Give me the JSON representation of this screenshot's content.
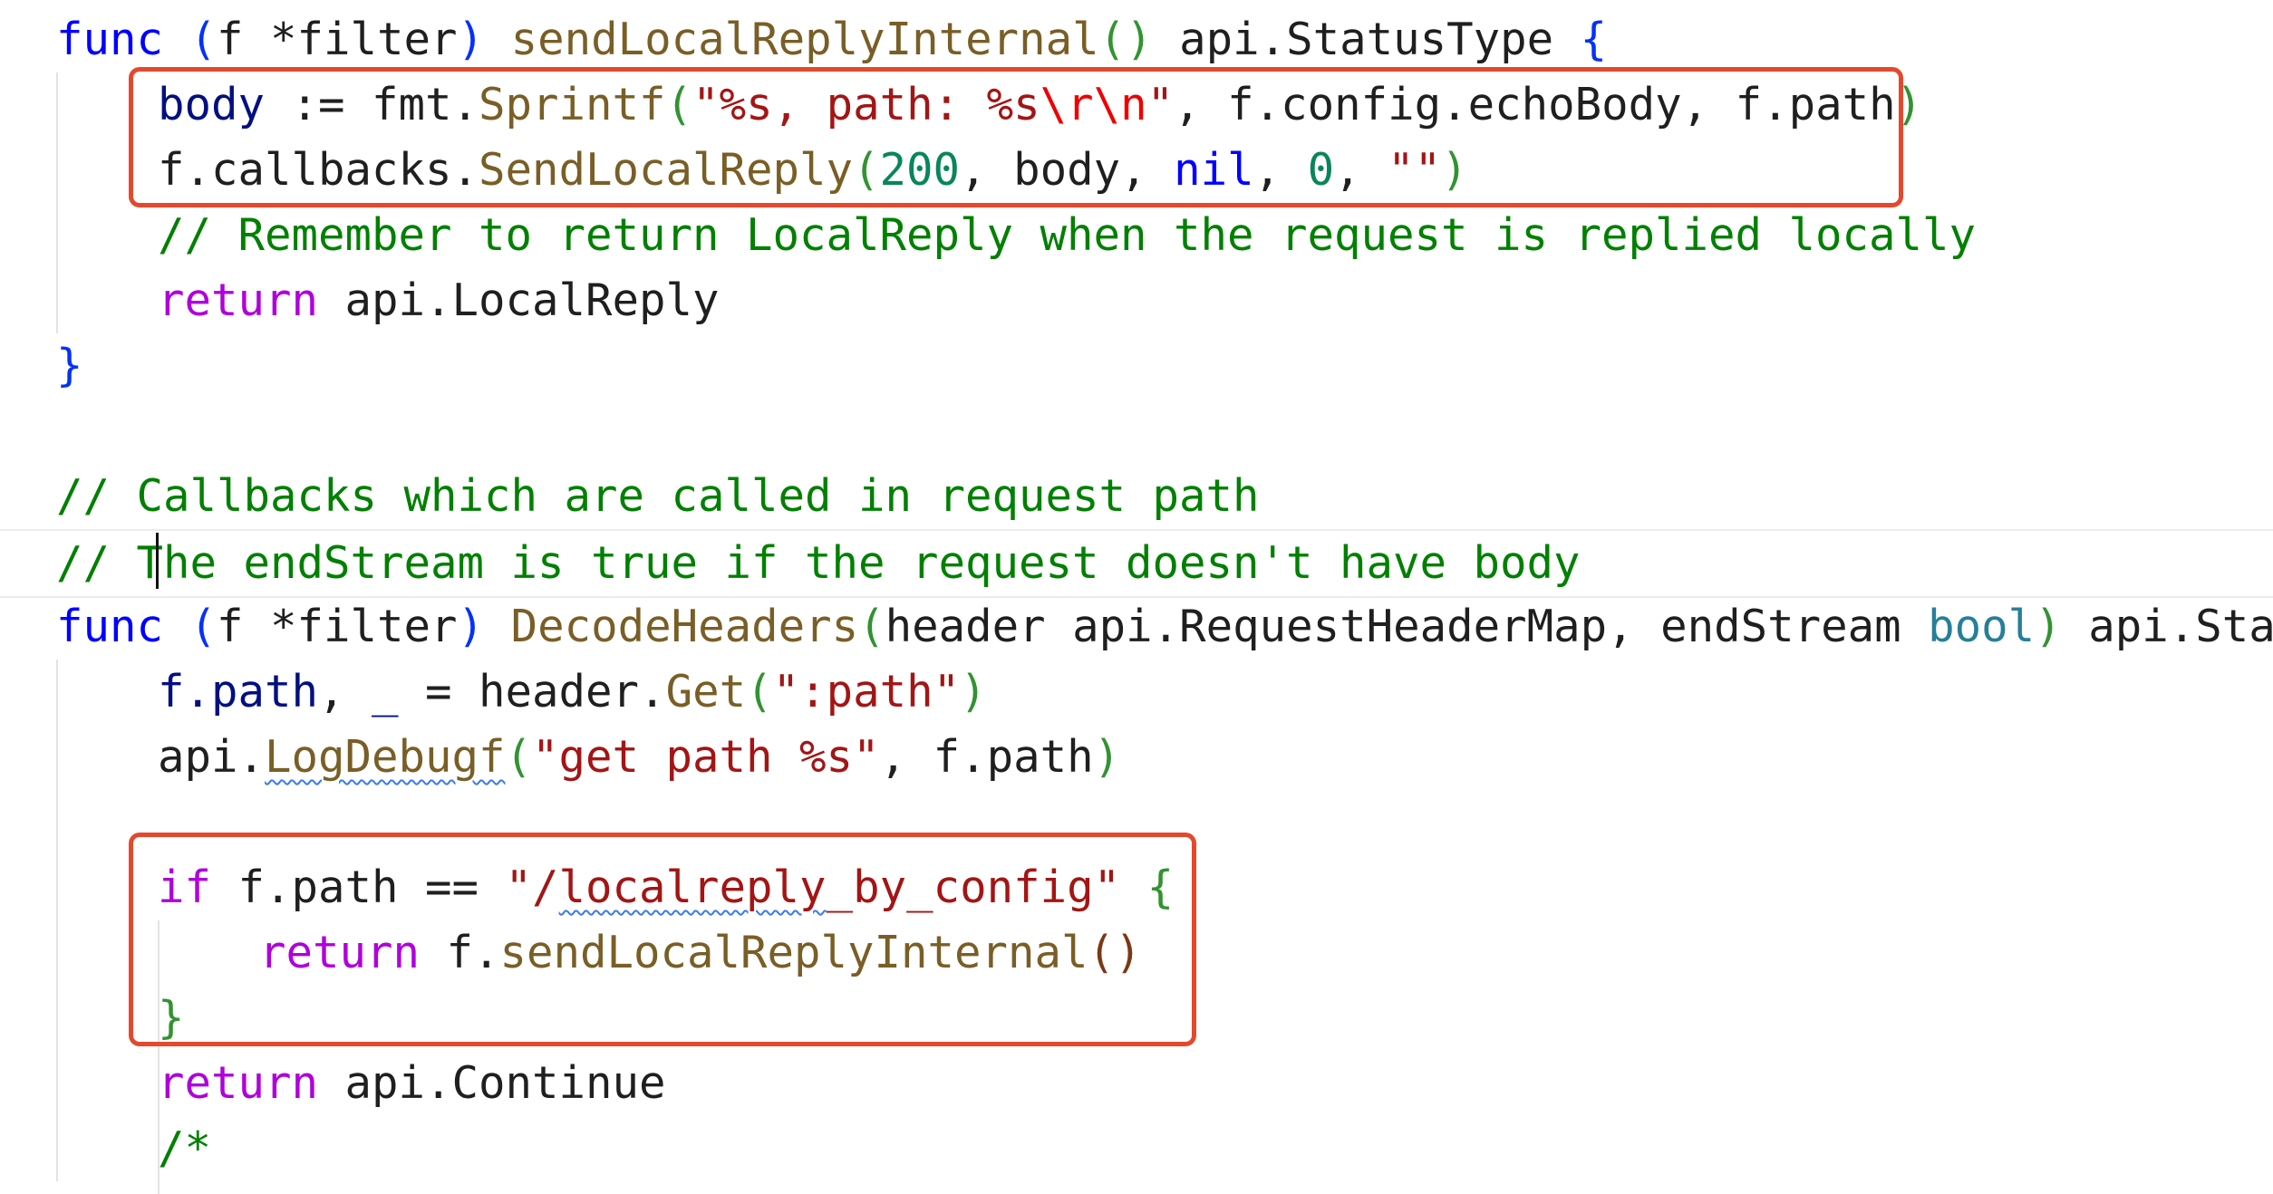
{
  "editor": {
    "highlight_color": "#e5482c",
    "lines": [
      {
        "indent": 0,
        "tokens": [
          {
            "t": "func",
            "c": "kw"
          },
          {
            "t": " "
          },
          {
            "t": "(",
            "c": "brace-blue"
          },
          {
            "t": "f *filter"
          },
          {
            "t": ")",
            "c": "brace-blue"
          },
          {
            "t": " "
          },
          {
            "t": "sendLocalReplyInternal",
            "c": "fn"
          },
          {
            "t": "()",
            "c": "brace-green"
          },
          {
            "t": " api.StatusType "
          },
          {
            "t": "{",
            "c": "brace-blue"
          }
        ]
      },
      {
        "indent": 1,
        "tokens": [
          {
            "t": "body",
            "c": "var"
          },
          {
            "t": " := fmt."
          },
          {
            "t": "Sprintf",
            "c": "fn"
          },
          {
            "t": "(",
            "c": "brace-green"
          },
          {
            "t": "\"%s, path: %s",
            "c": "str"
          },
          {
            "t": "\\r\\n",
            "c": "esc"
          },
          {
            "t": "\"",
            "c": "str"
          },
          {
            "t": ", f.config.echoBody, f.path"
          },
          {
            "t": ")",
            "c": "brace-green"
          }
        ]
      },
      {
        "indent": 1,
        "tokens": [
          {
            "t": "f.callbacks."
          },
          {
            "t": "SendLocalReply",
            "c": "fn"
          },
          {
            "t": "(",
            "c": "brace-green"
          },
          {
            "t": "200",
            "c": "num"
          },
          {
            "t": ", body, "
          },
          {
            "t": "nil",
            "c": "kw"
          },
          {
            "t": ", "
          },
          {
            "t": "0",
            "c": "num"
          },
          {
            "t": ", "
          },
          {
            "t": "\"\"",
            "c": "str"
          },
          {
            "t": ")",
            "c": "brace-green"
          }
        ]
      },
      {
        "indent": 1,
        "tokens": [
          {
            "t": "// Remember to return LocalReply when the request is replied locally",
            "c": "com"
          }
        ]
      },
      {
        "indent": 1,
        "tokens": [
          {
            "t": "return",
            "c": "ctrl"
          },
          {
            "t": " api.LocalReply"
          }
        ]
      },
      {
        "indent": 0,
        "tokens": [
          {
            "t": "}",
            "c": "brace-blue"
          }
        ]
      },
      {
        "indent": 0,
        "tokens": []
      },
      {
        "indent": 0,
        "tokens": [
          {
            "t": "// Callbacks which are called in request path",
            "c": "com"
          }
        ]
      },
      {
        "indent": 0,
        "current": true,
        "tokens": [
          {
            "t": "// The endStream is true if the request doesn't have body",
            "c": "com"
          }
        ]
      },
      {
        "indent": 0,
        "tokens": [
          {
            "t": "func",
            "c": "kw"
          },
          {
            "t": " "
          },
          {
            "t": "(",
            "c": "brace-blue"
          },
          {
            "t": "f *filter"
          },
          {
            "t": ")",
            "c": "brace-blue"
          },
          {
            "t": " "
          },
          {
            "t": "DecodeHeaders",
            "c": "fn"
          },
          {
            "t": "(",
            "c": "brace-green"
          },
          {
            "t": "header api.RequestHeaderMap, endStream "
          },
          {
            "t": "bool",
            "c": "type"
          },
          {
            "t": ")",
            "c": "brace-green"
          },
          {
            "t": " api.StatusType "
          },
          {
            "t": "{",
            "c": "brace-blue"
          }
        ]
      },
      {
        "indent": 1,
        "tokens": [
          {
            "t": "f.path",
            "c": "var"
          },
          {
            "t": ", "
          },
          {
            "t": "_",
            "c": "var"
          },
          {
            "t": " = header."
          },
          {
            "t": "Get",
            "c": "fn"
          },
          {
            "t": "(",
            "c": "brace-green"
          },
          {
            "t": "\":path\"",
            "c": "str"
          },
          {
            "t": ")",
            "c": "brace-green"
          }
        ]
      },
      {
        "indent": 1,
        "tokens": [
          {
            "t": "api."
          },
          {
            "t": "LogDebugf",
            "c": "fn",
            "squiggle": true
          },
          {
            "t": "(",
            "c": "brace-green"
          },
          {
            "t": "\"get path %s\"",
            "c": "str"
          },
          {
            "t": ", f.path"
          },
          {
            "t": ")",
            "c": "brace-green"
          }
        ]
      },
      {
        "indent": 1,
        "tokens": []
      },
      {
        "indent": 1,
        "tokens": [
          {
            "t": "if",
            "c": "ctrl"
          },
          {
            "t": " f.path == "
          },
          {
            "t": "\"/",
            "c": "str"
          },
          {
            "t": "localreply",
            "c": "str",
            "squiggle": true
          },
          {
            "t": "_by_config\"",
            "c": "str"
          },
          {
            "t": " "
          },
          {
            "t": "{",
            "c": "brace-green"
          }
        ]
      },
      {
        "indent": 2,
        "tokens": [
          {
            "t": "return",
            "c": "ctrl"
          },
          {
            "t": " f."
          },
          {
            "t": "sendLocalReplyInternal",
            "c": "fn"
          },
          {
            "t": "()",
            "c": "brace-purple"
          }
        ]
      },
      {
        "indent": 1,
        "tokens": [
          {
            "t": "}",
            "c": "brace-green"
          }
        ]
      },
      {
        "indent": 1,
        "tokens": [
          {
            "t": "return",
            "c": "ctrl"
          },
          {
            "t": " api.Continue"
          }
        ]
      },
      {
        "indent": 1,
        "tokens": [
          {
            "t": "/*",
            "c": "com"
          }
        ]
      }
    ]
  }
}
